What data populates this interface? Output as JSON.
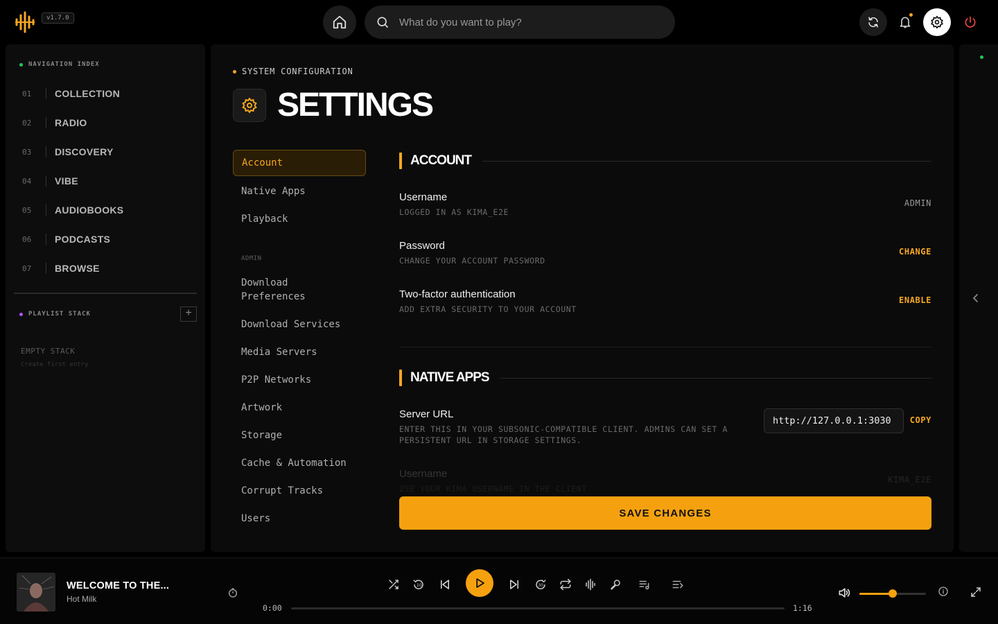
{
  "app": {
    "version": "v1.7.0",
    "search_placeholder": "What do you want to play?",
    "colors": {
      "accent": "#f5a623",
      "background": "#000000",
      "panel": "#0b0b0b",
      "power": "#ef4444",
      "online": "#22c55e",
      "playlist_dot": "#a855f7"
    }
  },
  "sidebar": {
    "nav_header": "NAVIGATION INDEX",
    "items": [
      {
        "num": "01",
        "label": "COLLECTION"
      },
      {
        "num": "02",
        "label": "RADIO"
      },
      {
        "num": "03",
        "label": "DISCOVERY"
      },
      {
        "num": "04",
        "label": "VIBE"
      },
      {
        "num": "05",
        "label": "AUDIOBOOKS"
      },
      {
        "num": "06",
        "label": "PODCASTS"
      },
      {
        "num": "07",
        "label": "BROWSE"
      }
    ],
    "playlist_header": "PLAYLIST STACK",
    "add_label": "+",
    "empty_title": "EMPTY STACK",
    "empty_sub": "Create first entry"
  },
  "main": {
    "eyebrow": "SYSTEM CONFIGURATION",
    "title": "SETTINGS",
    "subnav": {
      "items": [
        "Account",
        "Native Apps",
        "Playback"
      ],
      "admin_group": "ADMIN",
      "admin_items": [
        "Download Preferences",
        "Download Services",
        "Media Servers",
        "P2P Networks",
        "Artwork",
        "Storage",
        "Cache & Automation",
        "Corrupt Tracks",
        "Users"
      ],
      "active": "Account"
    },
    "account": {
      "title": "ACCOUNT",
      "username": {
        "title": "Username",
        "sub": "LOGGED IN AS KIMA_E2E",
        "value": "ADMIN"
      },
      "password": {
        "title": "Password",
        "sub": "CHANGE YOUR ACCOUNT PASSWORD",
        "action": "CHANGE"
      },
      "twofa": {
        "title": "Two-factor authentication",
        "sub": "ADD EXTRA SECURITY TO YOUR ACCOUNT",
        "action": "ENABLE"
      }
    },
    "native_apps": {
      "title": "NATIVE APPS",
      "server_url": {
        "title": "Server URL",
        "sub": "ENTER THIS IN YOUR SUBSONIC-COMPATIBLE CLIENT. ADMINS CAN SET A PERSISTENT URL IN STORAGE SETTINGS.",
        "value": "http://127.0.0.1:3030",
        "action": "COPY"
      },
      "username": {
        "title": "Username",
        "sub": "USE YOUR KIMA USERNAME IN THE CLIENT",
        "value": "KIMA_E2E"
      }
    },
    "save_label": "SAVE CHANGES"
  },
  "player": {
    "track_title": "WELCOME TO THE...",
    "artist": "Hot Milk",
    "time_current": "0:00",
    "time_total": "1:16",
    "progress": 0,
    "volume": 0.5
  }
}
